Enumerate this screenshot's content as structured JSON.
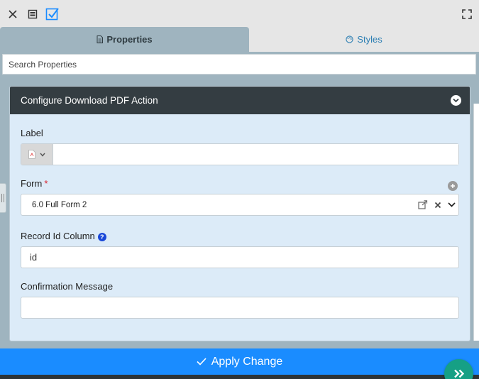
{
  "toolbar": {
    "close_icon": "close-icon",
    "panel_icon": "panel-icon",
    "check_icon": "checkbox-icon",
    "expand_icon": "fullscreen-icon"
  },
  "tabs": [
    {
      "label": "Properties",
      "icon": "document-icon",
      "active": true
    },
    {
      "label": "Styles",
      "icon": "palette-icon",
      "active": false
    }
  ],
  "search": {
    "placeholder": "Search Properties",
    "value": ""
  },
  "section": {
    "title": "Configure Download PDF Action",
    "fields": {
      "label": {
        "label": "Label",
        "value": "",
        "icon": "pdf-file-icon"
      },
      "form": {
        "label": "Form",
        "required_mark": "*",
        "value": "6.0 Full Form 2"
      },
      "record_id": {
        "label": "Record Id Column",
        "help": "?",
        "value": "id"
      },
      "confirmation": {
        "label": "Confirmation Message",
        "value": ""
      }
    }
  },
  "apply_button": {
    "label": "Apply Change"
  },
  "colors": {
    "accent_blue": "#1a8cff",
    "header_dark": "#343d42",
    "panel_blue": "#dcebf8",
    "tab_active": "#9fb4bf",
    "fab_green": "#16a085",
    "required_red": "#d9232e"
  }
}
